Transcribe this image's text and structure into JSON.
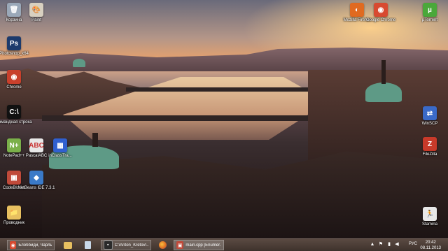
{
  "desktop": {
    "icons": [
      {
        "id": "recycle-bin",
        "label": "Корзина",
        "icon": "recycle-bin-icon",
        "glyph": "🗑",
        "color": "#9aa8b8"
      },
      {
        "id": "paint",
        "label": "Paint",
        "icon": "paint-icon",
        "glyph": "🎨",
        "color": "#d8d0c0"
      },
      {
        "id": "photoshop",
        "label": "Photoshop_x64",
        "icon": "photoshop-icon",
        "glyph": "Ps",
        "color": "#1c3a6c"
      },
      {
        "id": "chrome-left",
        "label": "Chrome",
        "icon": "chrome-icon",
        "glyph": "◉",
        "color": "#c8402c"
      },
      {
        "id": "cmd",
        "label": "Командная строка",
        "icon": "command-prompt-icon",
        "glyph": "C:\\",
        "color": "#111111"
      },
      {
        "id": "notepadpp",
        "label": "NotePad++",
        "icon": "notepad-plus-plus-icon",
        "glyph": "N+",
        "color": "#7ab04a"
      },
      {
        "id": "pascal",
        "label": "PascalABC",
        "icon": "pascal-abc-icon",
        "glyph": "ABC",
        "color": "#e8e8e8"
      },
      {
        "id": "inclass",
        "label": "inClassTra...",
        "icon": "inclass-icon",
        "glyph": "▦",
        "color": "#3060d0"
      },
      {
        "id": "codeblocks",
        "label": "CodeBlocks",
        "icon": "codeblocks-icon",
        "glyph": "▣",
        "color": "#c04a3a"
      },
      {
        "id": "netbeans",
        "label": "NetBeans IDE 7.3.1",
        "icon": "netbeans-icon",
        "glyph": "◆",
        "color": "#3a7ac8"
      },
      {
        "id": "explorer",
        "label": "Проводник",
        "icon": "file-explorer-icon",
        "glyph": "📁",
        "color": "#e8c060"
      },
      {
        "id": "firefox",
        "label": "Mozilla Firefox",
        "icon": "firefox-icon",
        "glyph": "◐",
        "color": "#e06a20"
      },
      {
        "id": "chrome-top",
        "label": "Google Chrome",
        "icon": "chrome-icon",
        "glyph": "◉",
        "color": "#d84a30"
      },
      {
        "id": "utorrent",
        "label": "µTorrent",
        "icon": "utorrent-icon",
        "glyph": "µ",
        "color": "#4aa83a"
      },
      {
        "id": "winscp",
        "label": "WinSCP",
        "icon": "winscp-icon",
        "glyph": "⇄",
        "color": "#3a6ac8"
      },
      {
        "id": "filezilla",
        "label": "FileZilla",
        "icon": "filezilla-icon",
        "glyph": "Z",
        "color": "#c83a2a"
      },
      {
        "id": "stamina",
        "label": "Stamina",
        "icon": "stamina-icon",
        "glyph": "🏃",
        "color": "#e8e8e8"
      }
    ]
  },
  "taskbar": {
    "buttons": [
      {
        "id": "browser",
        "label": "Блоббиди, Чарльз...",
        "icon": "chrome-icon",
        "color": "#d84a30",
        "glyph": "◉"
      },
      {
        "id": "terminal",
        "label": "C:\\Anton_Kretov\\...",
        "icon": "command-prompt-icon",
        "color": "#2a2a2a",
        "glyph": "▪"
      },
      {
        "id": "editor",
        "label": "main.cpp [Enumer...",
        "icon": "codeblocks-icon",
        "color": "#c04a3a",
        "glyph": "▣"
      }
    ],
    "pinned": [
      {
        "id": "explorer",
        "icon": "file-explorer-icon",
        "color": "#e8c060",
        "glyph": "▬"
      },
      {
        "id": "notes",
        "icon": "document-icon",
        "color": "#c8d8e8",
        "glyph": "▤"
      },
      {
        "id": "firefox",
        "icon": "firefox-icon",
        "color": "#e06a20",
        "glyph": "◐"
      }
    ],
    "tray": {
      "language": "РУС",
      "time": "20:42",
      "date": "08.11.2013"
    }
  }
}
